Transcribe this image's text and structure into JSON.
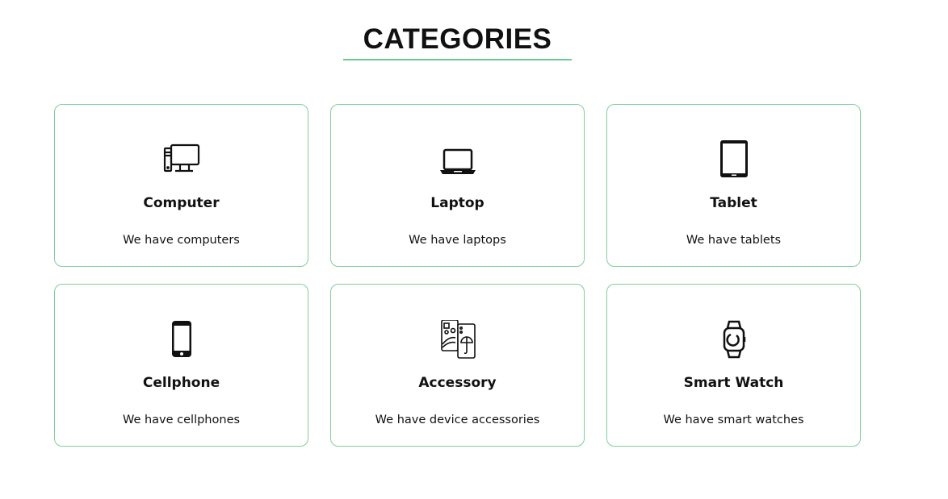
{
  "heading": "CATEGORIES",
  "accent_color": "#6cc792",
  "categories": [
    {
      "title": "Computer",
      "description": "We have computers",
      "icon": "desktop-computer-icon"
    },
    {
      "title": "Laptop",
      "description": "We have laptops",
      "icon": "laptop-icon"
    },
    {
      "title": "Tablet",
      "description": "We have tablets",
      "icon": "tablet-icon"
    },
    {
      "title": "Cellphone",
      "description": "We have cellphones",
      "icon": "cellphone-icon"
    },
    {
      "title": "Accessory",
      "description": "We have device accessories",
      "icon": "phone-case-accessory-icon"
    },
    {
      "title": "Smart Watch",
      "description": "We have smart watches",
      "icon": "smart-watch-icon"
    }
  ]
}
